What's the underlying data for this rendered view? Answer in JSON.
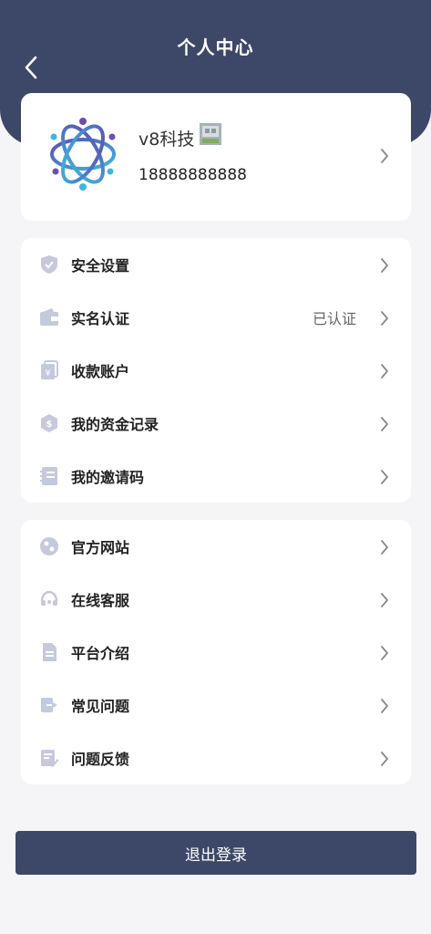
{
  "header": {
    "title": "个人中心"
  },
  "profile": {
    "name": "v8科技",
    "phone": "18888888888"
  },
  "menu_group_1": [
    {
      "label": "安全设置",
      "value": "",
      "icon": "shield-icon"
    },
    {
      "label": "实名认证",
      "value": "已认证",
      "icon": "wallet-icon"
    },
    {
      "label": "收款账户",
      "value": "",
      "icon": "yuan-card-icon"
    },
    {
      "label": "我的资金记录",
      "value": "",
      "icon": "dollar-hex-icon"
    },
    {
      "label": "我的邀请码",
      "value": "",
      "icon": "notebook-icon"
    }
  ],
  "menu_group_2": [
    {
      "label": "官方网站",
      "value": "",
      "icon": "globe-icon"
    },
    {
      "label": "在线客服",
      "value": "",
      "icon": "headset-icon"
    },
    {
      "label": "平台介绍",
      "value": "",
      "icon": "document-icon"
    },
    {
      "label": "常见问题",
      "value": "",
      "icon": "exit-icon"
    },
    {
      "label": "问题反馈",
      "value": "",
      "icon": "edit-note-icon"
    }
  ],
  "logout": {
    "label": "退出登录"
  },
  "colors": {
    "primary": "#3d4767",
    "icon": "#c4c9dc",
    "background": "#f5f5f7"
  }
}
